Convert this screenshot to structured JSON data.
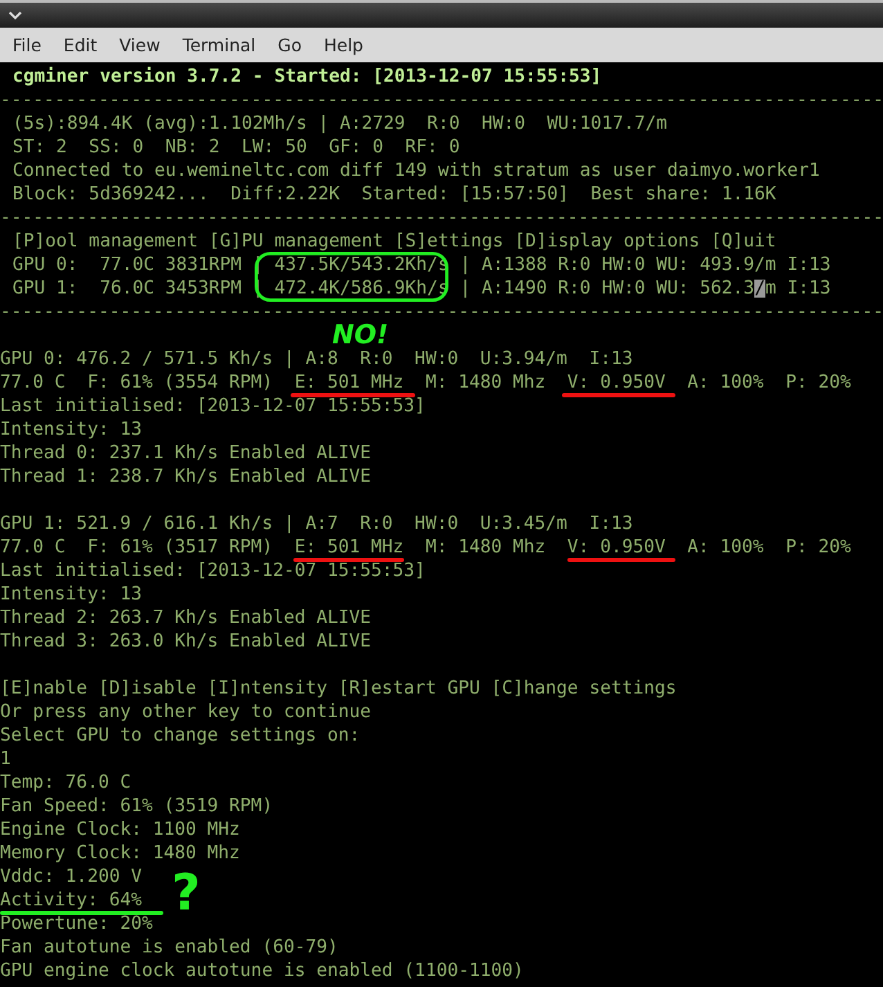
{
  "window": {
    "menu": [
      "File",
      "Edit",
      "View",
      "Terminal",
      "Go",
      "Help"
    ]
  },
  "terminal": {
    "lines": [
      {
        "kind": "header",
        "text": "cgminer version 3.7.2 - Started: [2013-12-07 15:55:53]"
      },
      {
        "kind": "rule",
        "text": "---------------------------------------------------------------------------------"
      },
      {
        "kind": "status",
        "text": "(5s):894.4K (avg):1.102Mh/s | A:2729  R:0  HW:0  WU:1017.7/m"
      },
      {
        "kind": "status",
        "text": "ST: 2  SS: 0  NB: 2  LW: 50  GF: 0  RF: 0"
      },
      {
        "kind": "status",
        "text": "Connected to eu.wemineltc.com diff 149 with stratum as user daimyo.worker1"
      },
      {
        "kind": "status",
        "text": "Block: 5d369242...  Diff:2.22K  Started: [15:57:50]  Best share: 1.16K"
      },
      {
        "kind": "rule",
        "text": "---------------------------------------------------------------------------------"
      },
      {
        "kind": "status",
        "text": "[P]ool management [G]PU management [S]ettings [D]isplay options [Q]uit"
      },
      {
        "kind": "status",
        "text": "GPU 0:  77.0C 3831RPM | 437.5K/543.2Kh/s | A:1388 R:0 HW:0 WU: 493.9/m I:13"
      },
      {
        "kind": "status",
        "text": "GPU 1:  76.0C 3453RPM | 472.4K/586.9Kh/s | A:1490 R:0 HW:0 WU: 562.3",
        "cursor": "/",
        "after": "m I:13"
      },
      {
        "kind": "rule",
        "text": "---------------------------------------------------------------------------------"
      },
      {
        "kind": "blank"
      },
      {
        "kind": "plain",
        "text": "GPU 0: 476.2 / 571.5 Kh/s | A:8  R:0  HW:0  U:3.94/m  I:13"
      },
      {
        "kind": "plain",
        "text": "77.0 C  F: 61% (3554 RPM)  E: 501 MHz  M: 1480 Mhz  V: 0.950V  A: 100%  P: 20%"
      },
      {
        "kind": "plain",
        "text": "Last initialised: [2013-12-07 15:55:53]"
      },
      {
        "kind": "plain",
        "text": "Intensity: 13"
      },
      {
        "kind": "plain",
        "text": "Thread 0: 237.1 Kh/s Enabled ALIVE"
      },
      {
        "kind": "plain",
        "text": "Thread 1: 238.7 Kh/s Enabled ALIVE"
      },
      {
        "kind": "blank"
      },
      {
        "kind": "plain",
        "text": "GPU 1: 521.9 / 616.1 Kh/s | A:7  R:0  HW:0  U:3.45/m  I:13"
      },
      {
        "kind": "plain",
        "text": "77.0 C  F: 61% (3517 RPM)  E: 501 MHz  M: 1480 Mhz  V: 0.950V  A: 100%  P: 20%"
      },
      {
        "kind": "plain",
        "text": "Last initialised: [2013-12-07 15:55:53]"
      },
      {
        "kind": "plain",
        "text": "Intensity: 13"
      },
      {
        "kind": "plain",
        "text": "Thread 2: 263.7 Kh/s Enabled ALIVE"
      },
      {
        "kind": "plain",
        "text": "Thread 3: 263.0 Kh/s Enabled ALIVE"
      },
      {
        "kind": "blank"
      },
      {
        "kind": "plain",
        "text": "[E]nable [D]isable [I]ntensity [R]estart GPU [C]hange settings"
      },
      {
        "kind": "plain",
        "text": "Or press any other key to continue"
      },
      {
        "kind": "plain",
        "text": "Select GPU to change settings on:"
      },
      {
        "kind": "plain",
        "text": "1"
      },
      {
        "kind": "plain",
        "text": "Temp: 76.0 C"
      },
      {
        "kind": "plain",
        "text": "Fan Speed: 61% (3519 RPM)"
      },
      {
        "kind": "plain",
        "text": "Engine Clock: 1100 MHz"
      },
      {
        "kind": "plain",
        "text": "Memory Clock: 1480 Mhz"
      },
      {
        "kind": "plain",
        "text": "Vddc: 1.200 V"
      },
      {
        "kind": "plain",
        "text": "Activity: 64%"
      },
      {
        "kind": "plain",
        "text": "Powertune: 20%"
      },
      {
        "kind": "plain",
        "text": "Fan autotune is enabled (60-79)"
      },
      {
        "kind": "plain",
        "text": "GPU engine clock autotune is enabled (1100-1100)"
      }
    ]
  },
  "annotations": [
    {
      "kind": "circle",
      "color": "#22ee22"
    },
    {
      "kind": "note",
      "text": "NO!",
      "color": "#22ee22"
    },
    {
      "kind": "underline",
      "color": "#ee1111"
    },
    {
      "kind": "underline",
      "color": "#ee1111"
    },
    {
      "kind": "underline",
      "color": "#ee1111"
    },
    {
      "kind": "underline",
      "color": "#ee1111"
    },
    {
      "kind": "underline",
      "color": "#22ee22"
    },
    {
      "kind": "note",
      "text": "?",
      "color": "#22ee22"
    }
  ]
}
